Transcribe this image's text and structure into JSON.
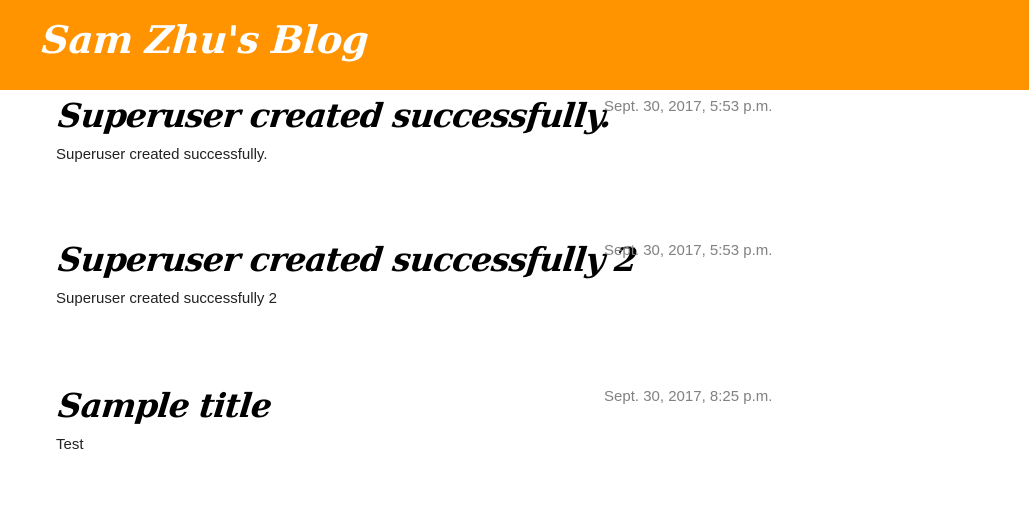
{
  "header": {
    "blog_title": "Sam Zhu's Blog"
  },
  "posts": [
    {
      "title": "Superuser created successfully.",
      "date": "Sept. 30, 2017, 5:53 p.m.",
      "body": "Superuser created successfully."
    },
    {
      "title": "Superuser created successfully 2",
      "date": "Sept. 30, 2017, 5:53 p.m.",
      "body": "Superuser created successfully 2"
    },
    {
      "title": "Sample title",
      "date": "Sept. 30, 2017, 8:25 p.m.",
      "body": "Test"
    }
  ],
  "colors": {
    "header_background": "#ff9400",
    "header_text": "#ffffff",
    "post_title": "#000000",
    "post_date": "#828282",
    "post_body": "#222222"
  }
}
